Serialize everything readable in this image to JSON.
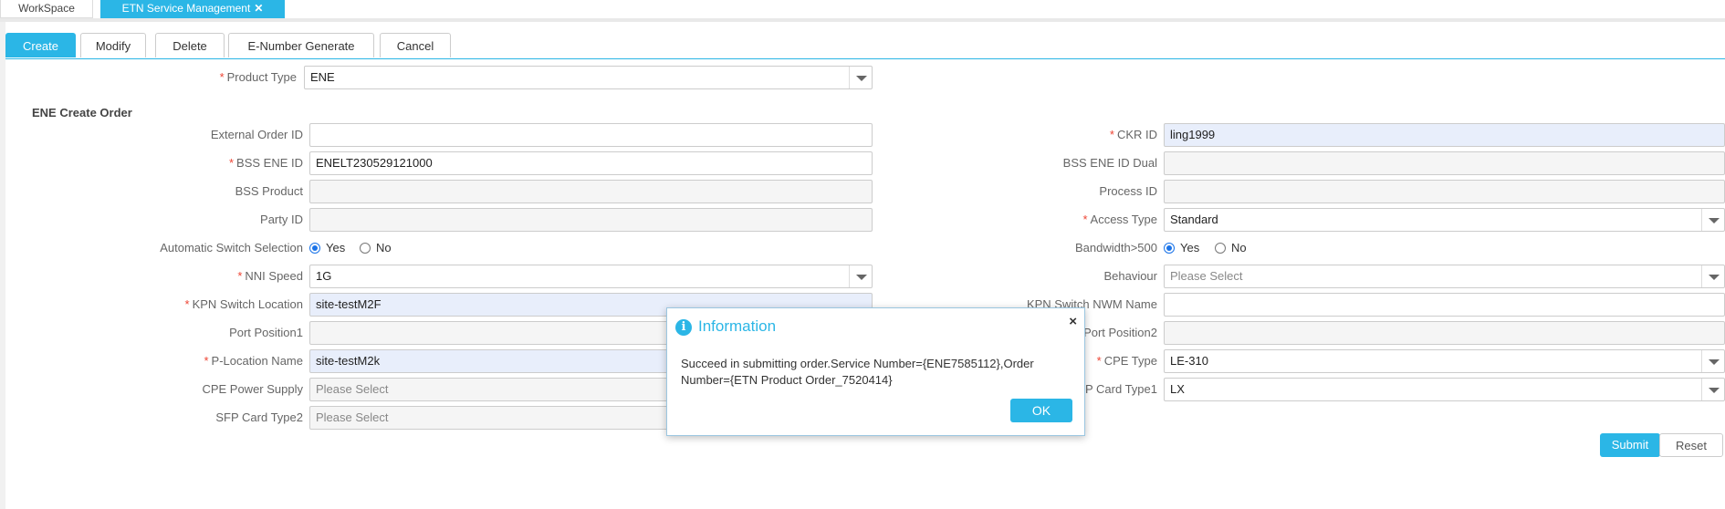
{
  "tabs": {
    "workspace": "WorkSpace",
    "etn": "ETN Service Management",
    "close_icon": "✕"
  },
  "toolbar": {
    "create": "Create",
    "modify": "Modify",
    "delete": "Delete",
    "enumber": "E-Number Generate",
    "cancel": "Cancel"
  },
  "product_type": {
    "label": "Product Type",
    "value": "ENE"
  },
  "section_title": "ENE Create Order",
  "left": {
    "external_order_id": {
      "label": "External Order ID",
      "value": ""
    },
    "bss_ene_id": {
      "label": "BSS ENE ID",
      "value": "ENELT230529121000"
    },
    "bss_product": {
      "label": "BSS Product",
      "value": ""
    },
    "party_id": {
      "label": "Party ID",
      "value": ""
    },
    "auto_switch": {
      "label": "Automatic Switch Selection",
      "yes": "Yes",
      "no": "No",
      "selected": "Yes"
    },
    "nni_speed": {
      "label": "NNI Speed",
      "value": "1G"
    },
    "kpn_switch_location": {
      "label": "KPN Switch Location",
      "value": "site-testM2F"
    },
    "port_position1": {
      "label": "Port Position1",
      "value": ""
    },
    "p_location_name": {
      "label": "P-Location Name",
      "value": "site-testM2k"
    },
    "cpe_power_supply": {
      "label": "CPE Power Supply",
      "value": "Please Select"
    },
    "sfp_card_type2": {
      "label": "SFP Card Type2",
      "value": "Please Select"
    }
  },
  "right": {
    "ckr_id": {
      "label": "CKR ID",
      "value": "ling1999"
    },
    "bss_ene_id_dual": {
      "label": "BSS ENE ID Dual",
      "value": ""
    },
    "process_id": {
      "label": "Process ID",
      "value": ""
    },
    "access_type": {
      "label": "Access Type",
      "value": "Standard"
    },
    "bandwidth": {
      "label": "Bandwidth>500",
      "yes": "Yes",
      "no": "No",
      "selected": "Yes"
    },
    "behaviour": {
      "label": "Behaviour",
      "value": "Please Select"
    },
    "kpn_switch_nwm_name": {
      "label": "KPN Switch NWM Name",
      "value": ""
    },
    "port_position2": {
      "label": "Port Position2",
      "value": ""
    },
    "cpe_type": {
      "label": "CPE Type",
      "value": "LE-310"
    },
    "sfp_card_type1": {
      "label": "SFP Card Type1",
      "value": "LX"
    }
  },
  "actions": {
    "submit": "Submit",
    "reset": "Reset"
  },
  "dialog": {
    "icon": "i",
    "title": "Information",
    "close": "×",
    "message": "Succeed in submitting order.Service Number={ENE7585112},Order Number={ETN Product Order_7520414}",
    "ok": "OK"
  }
}
